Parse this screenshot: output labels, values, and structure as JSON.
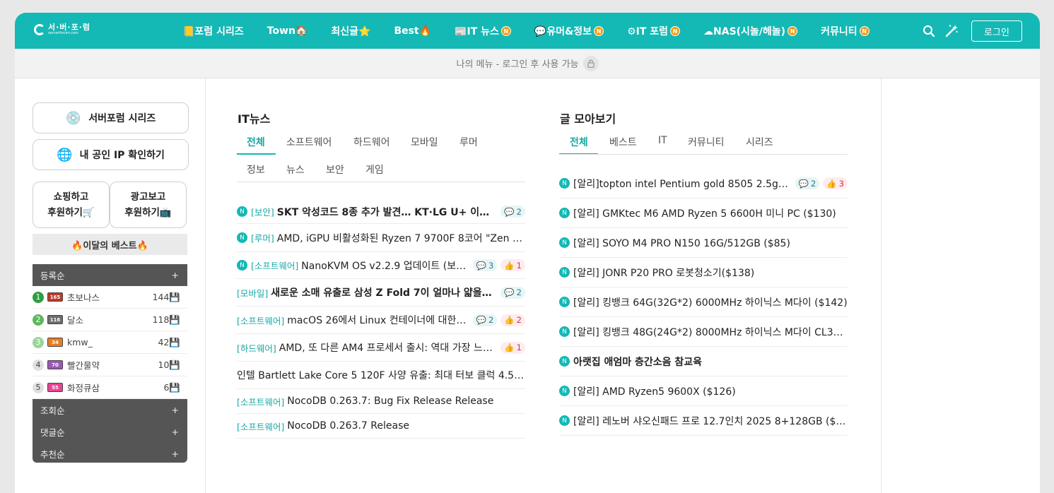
{
  "header": {
    "logo_text": "서·버·포·럼",
    "logo_sub": "serverforum.com",
    "nav": [
      {
        "label": "📒포럼 시리즈",
        "badge": ""
      },
      {
        "label": "Town🏠",
        "badge": ""
      },
      {
        "label": "최신글⭐",
        "badge": ""
      },
      {
        "label": "Best🔥",
        "badge": ""
      },
      {
        "label": "📰IT 뉴스",
        "badge": "N"
      },
      {
        "label": "💬유머&정보",
        "badge": "N"
      },
      {
        "label": "⚙IT 포럼",
        "badge": "N"
      },
      {
        "label": "☁NAS(시놀/헤놀)",
        "badge": "N"
      },
      {
        "label": "커뮤니티",
        "badge": "N"
      }
    ],
    "login_label": "로그인"
  },
  "my_menu": {
    "text": "나의 메뉴 - 로그인 후 사용 가능"
  },
  "sidebar": {
    "series_btn": {
      "icon": "💿",
      "label": "서버포럼 시리즈"
    },
    "ip_btn": {
      "icon": "🌐",
      "label": "내 공인 IP 확인하기"
    },
    "shop_btn": {
      "line1": "쇼핑하고",
      "line2": "후원하기🛒"
    },
    "ad_btn": {
      "line1": "광고보고",
      "line2": "후원하기📺"
    },
    "best_title": "🔥이달의 베스트🔥",
    "rank_groups": [
      {
        "label": "등록순",
        "toggle": "+"
      },
      {
        "label": "조회순",
        "toggle": "+"
      },
      {
        "label": "댓글순",
        "toggle": "+"
      },
      {
        "label": "추천순",
        "toggle": "+"
      }
    ],
    "rankings": [
      {
        "rank": "1",
        "level": "165",
        "name": "초보나스",
        "count": "144",
        "rank_color": "#2e9e3f",
        "level_color": "#c0392b"
      },
      {
        "rank": "2",
        "level": "116",
        "name": "달소",
        "count": "118",
        "rank_color": "#5cb85c",
        "level_color": "#6d6d6d"
      },
      {
        "rank": "3",
        "level": "34",
        "name": "kmw_",
        "count": "42",
        "rank_color": "#9bd49b",
        "level_color": "#e67e22"
      },
      {
        "rank": "4",
        "level": "70",
        "name": "빨간물약",
        "count": "10",
        "rank_color": "#e0e0e0",
        "level_color": "#9b59b6"
      },
      {
        "rank": "5",
        "level": "55",
        "name": "화정큐삼",
        "count": "6",
        "rank_color": "#e0e0e0",
        "level_color": "#e84393"
      }
    ],
    "save_icon": "💾"
  },
  "it_news": {
    "title": "IT뉴스",
    "tabs_row1": [
      "전체",
      "소프트웨어",
      "하드웨어",
      "모바일",
      "루머"
    ],
    "tabs_row2": [
      "정보",
      "뉴스",
      "보안",
      "게임"
    ],
    "items": [
      {
        "new": "N",
        "category": "[보안]",
        "title": "SKT 악성코드 8종 추가 발견… KT·LG U+ 이상무",
        "bold": true,
        "comments": "2",
        "likes": ""
      },
      {
        "new": "N",
        "category": "[루머]",
        "title": "AMD, iGPU 비활성화된 Ryzen 7 9700F 8코어 \"Zen 5\"…",
        "bold": false,
        "comments": "",
        "likes": ""
      },
      {
        "new": "N",
        "category": "[소프트웨어]",
        "title": "NanoKVM OS v2.2.9 업데이트 (보…",
        "bold": false,
        "comments": "3",
        "likes": "1"
      },
      {
        "new": "",
        "category": "[모바일]",
        "title": "새로운 소매 유출로 삼성 Z Fold 7이 얼마나 얇을지 …",
        "bold": true,
        "comments": "2",
        "likes": ""
      },
      {
        "new": "",
        "category": "[소프트웨어]",
        "title": "macOS 26에서 Linux 컨테이너에 대한 …",
        "bold": false,
        "comments": "2",
        "likes": "2"
      },
      {
        "new": "",
        "category": "[하드웨어]",
        "title": "AMD, 또 다른 AM4 프로세서 출시: 역대 가장 느…",
        "bold": false,
        "comments": "",
        "likes": "1"
      },
      {
        "new": "",
        "category": "",
        "title": "인텔 Bartlett Lake Core 5 120F 사양 유출: 최대 터보 클럭 4.5G…",
        "bold": false,
        "comments": "",
        "likes": ""
      },
      {
        "new": "",
        "category": "[소프트웨어]",
        "title": "NocoDB 0.263.7: Bug Fix Release Release",
        "bold": false,
        "comments": "",
        "likes": ""
      },
      {
        "new": "",
        "category": "[소프트웨어]",
        "title": "NocoDB 0.263.7 Release",
        "bold": false,
        "comments": "",
        "likes": ""
      }
    ]
  },
  "all_posts": {
    "title": "글 모아보기",
    "tabs": [
      "전체",
      "베스트",
      "IT",
      "커뮤니티",
      "시리즈"
    ],
    "items": [
      {
        "new": "N",
        "title": "[알리]topton intel Pentium gold 8505 2.5g 6p…",
        "bold": false,
        "comments": "2",
        "likes": "3"
      },
      {
        "new": "N",
        "title": "[알리] GMKtec M6 AMD Ryzen 5 6600H 미니 PC ($130)",
        "bold": false,
        "comments": "",
        "likes": ""
      },
      {
        "new": "N",
        "title": "[알리] SOYO M4 PRO N150 16G/512GB ($85)",
        "bold": false,
        "comments": "",
        "likes": ""
      },
      {
        "new": "N",
        "title": "[알리] JONR P20 PRO 로봇청소기($138)",
        "bold": false,
        "comments": "",
        "likes": ""
      },
      {
        "new": "N",
        "title": "[알리] 킹뱅크 64G(32G*2) 6000MHz 하이닉스 M다이 ($142)",
        "bold": false,
        "comments": "",
        "likes": ""
      },
      {
        "new": "N",
        "title": "[알리] 킹뱅크 48G(24G*2) 8000MHz 하이닉스 M다이 CL3…",
        "bold": false,
        "comments": "",
        "likes": ""
      },
      {
        "new": "N",
        "title": "아랫집 애엄마 층간소음 참교육",
        "bold": true,
        "comments": "",
        "likes": ""
      },
      {
        "new": "N",
        "title": "[알리] AMD Ryzen5 9600X ($126)",
        "bold": false,
        "comments": "",
        "likes": ""
      },
      {
        "new": "N",
        "title": "[알리] 레노버 샤오신패드 프로 12.7인치 2025 8+128GB ($…",
        "bold": false,
        "comments": "",
        "likes": ""
      }
    ]
  },
  "icons": {
    "comment": "💬",
    "like": "👍"
  },
  "colors": {
    "brand": "#14b8b5",
    "new_badge": "#f39c12"
  }
}
